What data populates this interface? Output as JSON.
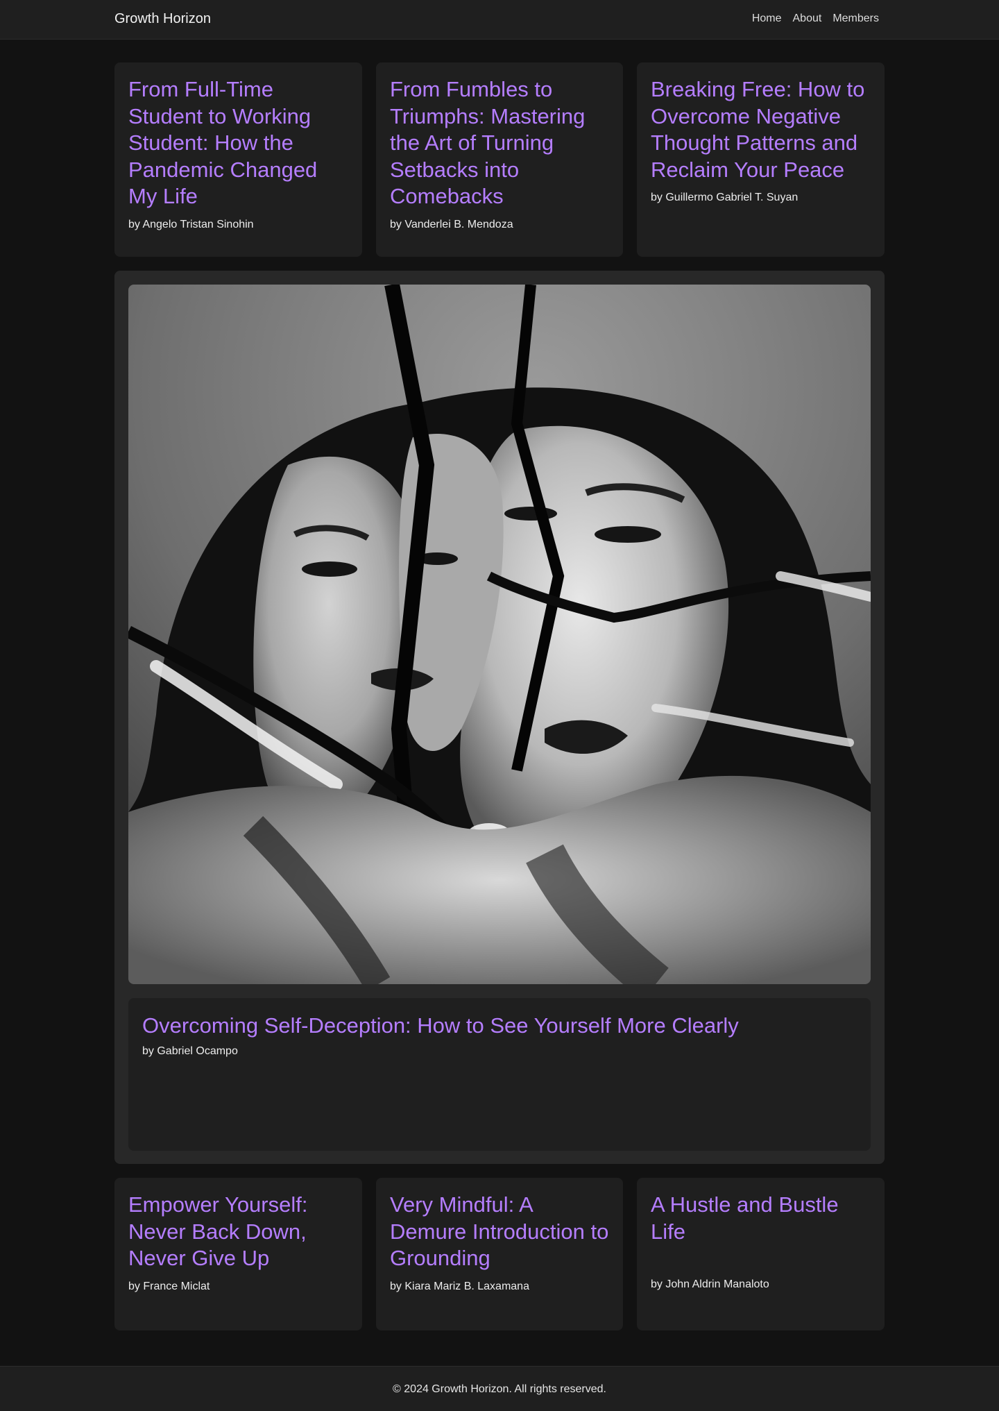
{
  "header": {
    "brand": "Growth Horizon",
    "nav": [
      "Home",
      "About",
      "Members"
    ]
  },
  "top_articles": [
    {
      "title": "From Full-Time Student to Working Student: How the Pandemic Changed My Life",
      "author": "by Angelo Tristan Sinohin"
    },
    {
      "title": "From Fumbles to Triumphs: Mastering the Art of Turning Setbacks into Comebacks",
      "author": "by Vanderlei B. Mendoza"
    },
    {
      "title": "Breaking Free: How to Overcome Negative Thought Patterns and Reclaim Your Peace",
      "author": "by Guillermo Gabriel T. Suyan"
    }
  ],
  "featured": {
    "image": "black-and-white-photo-of-woman-face-reflected-in-broken-mirror",
    "title": "Overcoming Self-Deception: How to See Yourself More Clearly",
    "author": "by Gabriel Ocampo"
  },
  "bottom_articles": [
    {
      "title": "Empower Yourself: Never Back Down, Never Give Up",
      "author": "by France Miclat"
    },
    {
      "title": "Very Mindful: A Demure Introduction to Grounding",
      "author": "by Kiara Mariz B. Laxamana"
    },
    {
      "title": "A Hustle and Bustle Life",
      "author": "by John Aldrin Manaloto"
    }
  ],
  "footer": {
    "text": "© 2024 Growth Horizon. All rights reserved."
  },
  "colors": {
    "background": "#121212",
    "card": "#1f1f1f",
    "accent": "#b57eff"
  }
}
